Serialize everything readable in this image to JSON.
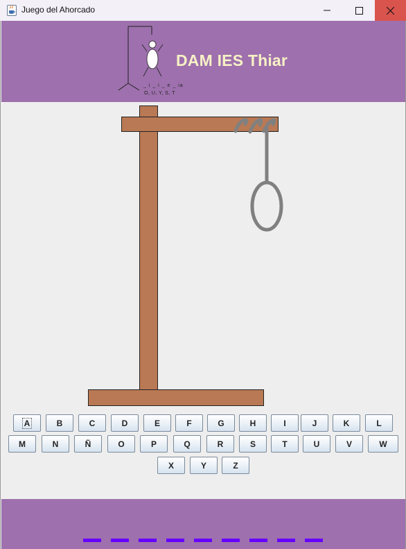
{
  "window": {
    "title": "Juego del Ahorcado",
    "icon": "java-cup-icon",
    "controls": {
      "minimize": "—",
      "maximize": "☐",
      "close": "✕"
    }
  },
  "header": {
    "brand": "DAM IES Thiar",
    "logo_letters_top": "_ i _ i _ e _ ia",
    "logo_letters_bottom": "O, U, Y, S, T",
    "background": "#9e70ad",
    "brand_color": "#f7f1c6"
  },
  "game": {
    "gallows_color": "#b97954",
    "rope_color": "#808080"
  },
  "keyboard": {
    "row1": [
      "A",
      "B",
      "C",
      "D",
      "E",
      "F",
      "G",
      "H",
      "I",
      "J",
      "K",
      "L"
    ],
    "row2": [
      "M",
      "N",
      "Ñ",
      "O",
      "P",
      "Q",
      "R",
      "S",
      "T",
      "U",
      "V",
      "W"
    ],
    "row3": [
      "X",
      "Y",
      "Z"
    ]
  },
  "word": {
    "hidden_letters": 9,
    "dash_color": "#6600ff"
  }
}
